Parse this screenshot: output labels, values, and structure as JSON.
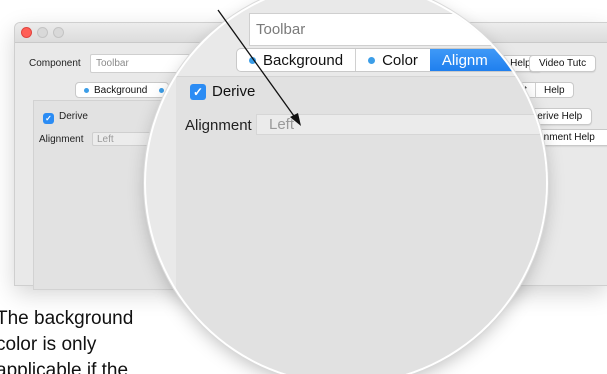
{
  "component": {
    "label": "Component",
    "value": "Toolbar"
  },
  "tabs_small": [
    "Background"
  ],
  "tabs_big": [
    {
      "label": "Background",
      "dot": true
    },
    {
      "label": "Color",
      "dot": true
    },
    {
      "label": "Alignm",
      "active": true
    }
  ],
  "derive": {
    "checked": true,
    "label": "Derive"
  },
  "alignment": {
    "label": "Alignment",
    "value": "Left"
  },
  "help_buttons": {
    "component_help": "nt Help",
    "video_tutorial": "Video Tutc",
    "font": "Font",
    "help": "Help",
    "derive_help": "Derive Help",
    "alignment_help": "Alignment Help"
  },
  "caption_lines": [
    "The background",
    "color is only",
    "applicable if the"
  ],
  "colors": {
    "accent": "#1f7fee",
    "close": "#ff5f57",
    "dot": "#3c9ee8"
  }
}
